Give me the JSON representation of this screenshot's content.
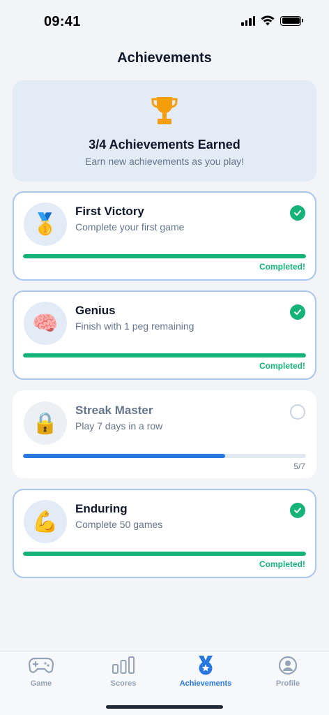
{
  "status_bar": {
    "time": "09:41"
  },
  "page_title": "Achievements",
  "summary": {
    "title": "3/4 Achievements Earned",
    "subtitle": "Earn new achievements as you play!",
    "icon": "trophy-icon"
  },
  "achievements": [
    {
      "title": "First Victory",
      "description": "Complete your first game",
      "icon": "🥇",
      "completed": true,
      "progress": 1.0,
      "progress_label": "Completed!"
    },
    {
      "title": "Genius",
      "description": "Finish with 1 peg remaining",
      "icon": "🧠",
      "completed": true,
      "progress": 1.0,
      "progress_label": "Completed!"
    },
    {
      "title": "Streak Master",
      "description": "Play 7 days in a row",
      "icon": "🔒",
      "completed": false,
      "progress": 0.714,
      "progress_label": "5/7"
    },
    {
      "title": "Enduring",
      "description": "Complete 50 games",
      "icon": "💪",
      "completed": true,
      "progress": 1.0,
      "progress_label": "Completed!"
    }
  ],
  "tabs": [
    {
      "label": "Game",
      "icon": "gamepad-icon",
      "active": false
    },
    {
      "label": "Scores",
      "icon": "bar-chart-icon",
      "active": false
    },
    {
      "label": "Achievements",
      "icon": "medal-icon",
      "active": true
    },
    {
      "label": "Profile",
      "icon": "profile-icon",
      "active": false
    }
  ],
  "colors": {
    "accent": "#2878e0",
    "success": "#16b378",
    "trophy": "#f59e0b",
    "muted": "#94a3b8"
  }
}
